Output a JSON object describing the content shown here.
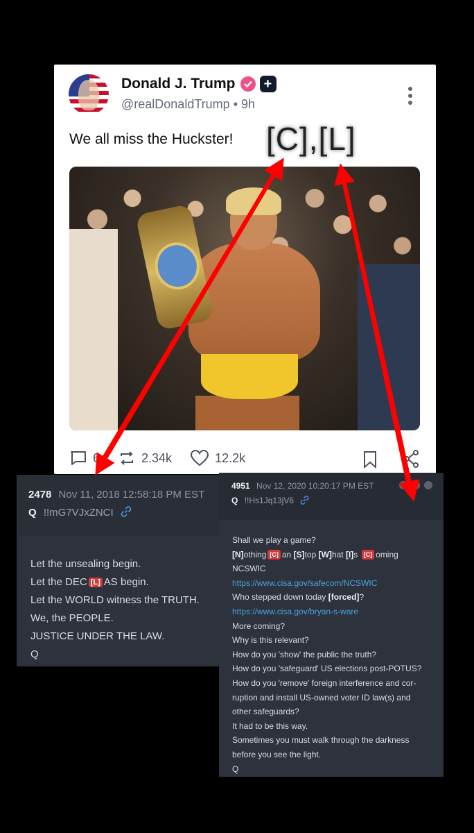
{
  "post": {
    "display_name": "Donald J. Trump",
    "handle": "@realDonaldTrump",
    "separator": "•",
    "time": "9h",
    "text": "We all miss the Huckster!",
    "reply_count": "6",
    "repost_count": "2.34k",
    "like_count": "12.2k"
  },
  "overlay": {
    "label": "[C],[L]",
    "arrow_color": "#ff0000"
  },
  "drop_left": {
    "number": "2478",
    "date": "Nov 11, 2018 12:58:18 PM EST",
    "author": "Q",
    "tripcode": "!!mG7VJxZNCI",
    "lines": [
      "Let the unsealing begin.",
      "Let the WORLD witness the TRUTH.",
      "We, the PEOPLE.",
      "JUSTICE UNDER THE LAW.",
      "Q"
    ],
    "dec_line": {
      "before": "Let the DEC",
      "tag": "[L]",
      "after": "AS begin."
    }
  },
  "drop_right": {
    "number": "4951",
    "date": "Nov 12, 2020 10:20:17 PM EST",
    "author": "Q",
    "tripcode": "!!Hs1Jq13jV6",
    "line1": "Shall we play a game?",
    "acrostic": {
      "n": "[N]",
      "n_rest": "othing",
      "tag1": "[C]",
      "c_rest": "an",
      "s": "[S]",
      "s_rest": "top",
      "w": "[W]",
      "w_rest": "hat",
      "i": "[I]",
      "i_rest": "s",
      "tag2": "[C]",
      "c2_rest": "oming"
    },
    "ncswic": "NCSWIC",
    "url1": "https://www.cisa.gov/safecom/NCSWIC",
    "stepped_before": "Who stepped down today",
    "stepped_bold": "[forced]",
    "stepped_after": "?",
    "url2": "https://www.cisa.gov/bryan-s-ware",
    "lines_after": [
      "More coming?",
      "Why is this relevant?",
      "How do you 'show' the public the truth?",
      "How do you 'safeguard' US elections post-POTUS?",
      "How do you 'remove' foreign interference and cor-",
      "ruption and install US-owned voter ID law(s) and",
      "other safeguards?",
      "It had to be this way.",
      "Sometimes you must walk through the darkness",
      "before you see the light.",
      "Q"
    ]
  },
  "colors": {
    "card_bg": "#2d323c",
    "tag_red": "#cf3b3b",
    "link_blue": "#4aa3df",
    "verified_pink": "#f0508a"
  }
}
